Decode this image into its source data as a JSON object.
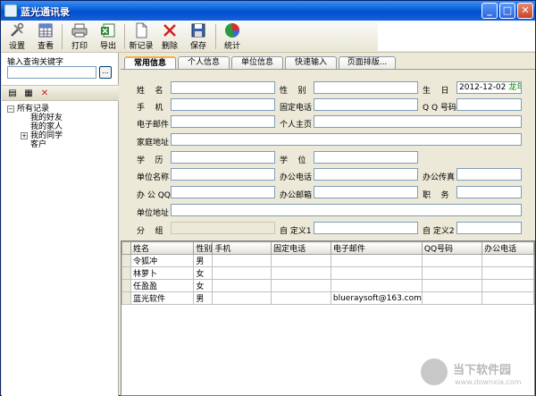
{
  "window": {
    "title": "蓝光通讯录",
    "minimize": "_",
    "maximize": "□",
    "close": "✕"
  },
  "toolbar": {
    "settings": "设置",
    "view": "查看",
    "print": "打印",
    "export": "导出",
    "new_record": "新记录",
    "delete": "删除",
    "save": "保存",
    "stats": "统计"
  },
  "left": {
    "search_label": "输入查询关键字",
    "search_value": "",
    "search_button": "...",
    "tree": {
      "root": "所有记录",
      "children": [
        "我的好友",
        "我的家人",
        "我的同学",
        "客户"
      ]
    }
  },
  "tabs": [
    "常用信息",
    "个人信息",
    "单位信息",
    "快速输入",
    "页面排版..."
  ],
  "form": {
    "name_label": "姓    名",
    "gender_label": "性    别",
    "birthday_label": "生    日",
    "birthday_value": "2012-12-02",
    "birthday_lunar": "龙年十",
    "mobile_label": "手    机",
    "home_phone_label": "固定电话",
    "qq_label": "Q Q 号码",
    "email_label": "电子邮件",
    "homepage_label": "个人主页",
    "home_address_label": "家庭地址",
    "education_label": "学    历",
    "degree_label": "学    位",
    "company_label": "单位名称",
    "office_phone_label": "办公电话",
    "office_fax_label": "办公传真",
    "office_qq_label": "办 公 QQ",
    "office_email_label": "办公邮箱",
    "title_label": "职    务",
    "company_address_label": "单位地址",
    "group_label": "分    组",
    "custom1_label": "自 定义1",
    "custom2_label": "自 定义2"
  },
  "grid": {
    "columns": [
      "姓名",
      "性别",
      "手机",
      "固定电话",
      "电子邮件",
      "QQ号码",
      "办公电话"
    ],
    "rows": [
      [
        "令狐冲",
        "男",
        "",
        "",
        "",
        "",
        ""
      ],
      [
        "林萝卜",
        "女",
        "",
        "",
        "",
        "",
        ""
      ],
      [
        "任盈盈",
        "女",
        "",
        "",
        "",
        "",
        ""
      ],
      [
        "蓝光软件",
        "男",
        "",
        "",
        "blueraysoft@163.com",
        "",
        ""
      ]
    ]
  },
  "watermark": {
    "title": "当下软件园",
    "subtitle": "www.downxia.com"
  }
}
